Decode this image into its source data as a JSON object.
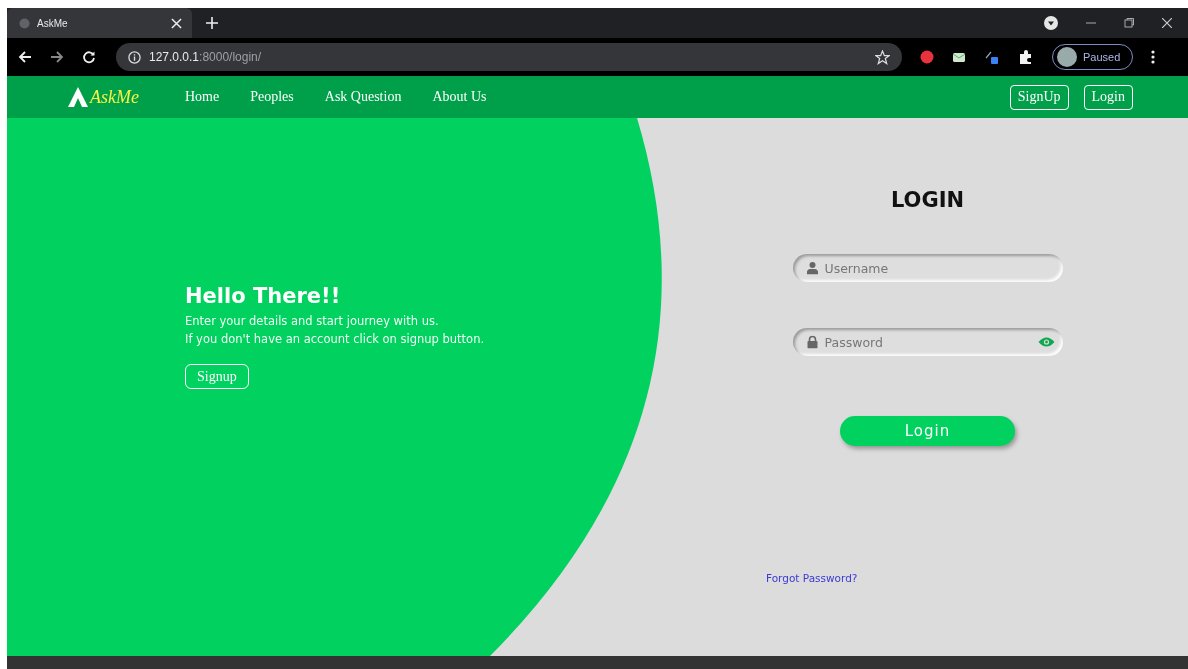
{
  "browser": {
    "tab_title": "AskMe",
    "url_host": "127.0.0.1",
    "url_rest": ":8000/login/",
    "profile_status": "Paused"
  },
  "navbar": {
    "brand": "AskMe",
    "links": [
      "Home",
      "Peoples",
      "Ask Question",
      "About Us"
    ],
    "buttons": [
      "SignUp",
      "Login"
    ]
  },
  "hero": {
    "title": "Hello There!!",
    "lines": [
      "Enter your details and start journey with us.",
      "If you don't have an account click on signup button."
    ],
    "button": "Signup"
  },
  "login": {
    "title": "LOGIN",
    "fields": [
      {
        "kind": "text",
        "placeholder": "Username"
      },
      {
        "kind": "password",
        "placeholder": "Password"
      }
    ],
    "button": "Login",
    "forgot_link": "Forgot Password?"
  }
}
